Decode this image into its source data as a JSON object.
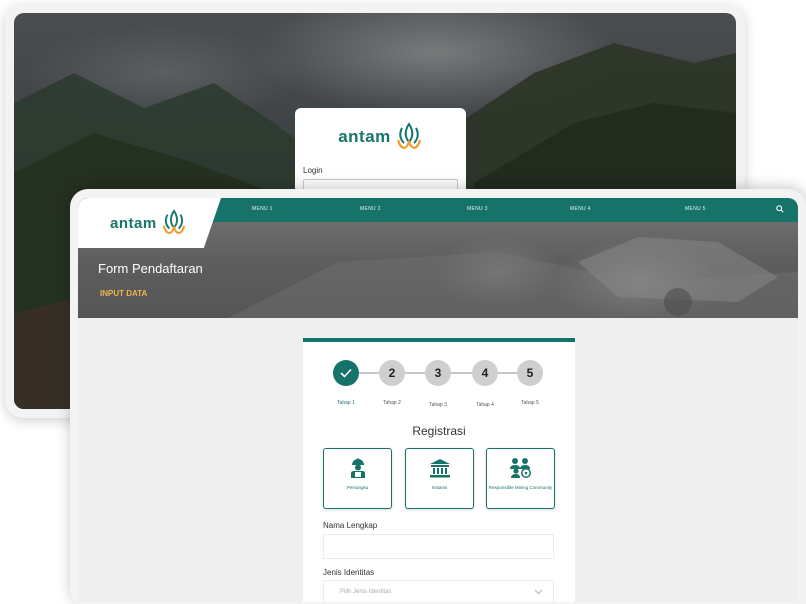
{
  "login": {
    "logo_text": "antam",
    "login_label": "Login"
  },
  "header": {
    "logo_text": "antam",
    "menu": [
      "MENU 1",
      "MENU 2",
      "MENU 3",
      "MENU 4",
      "MENU 5"
    ]
  },
  "hero": {
    "title": "Form Pendaftaran",
    "subtitle": "INPUT DATA"
  },
  "form": {
    "steps": [
      {
        "number": "",
        "label": "Tahap 1",
        "done": true
      },
      {
        "number": "2",
        "label": "Tahap 2",
        "done": false
      },
      {
        "number": "3",
        "label": "Tahap 3",
        "done": false
      },
      {
        "number": "4",
        "label": "Tahap 4",
        "done": false
      },
      {
        "number": "5",
        "label": "Tahap 5",
        "done": false
      }
    ],
    "title": "Registrasi",
    "options": [
      {
        "label": "Pemangku",
        "icon": "worker-icon"
      },
      {
        "label": "Instansi",
        "icon": "institution-icon"
      },
      {
        "label": "Responsible Mining Community",
        "icon": "community-icon"
      }
    ],
    "name_label": "Nama Lengkap",
    "name_value": "",
    "id_label": "Jenis Identitas",
    "id_placeholder": "Pilih Jenis Identitas"
  },
  "colors": {
    "brand": "#16736a",
    "accent": "#f0b54a",
    "logo_orange": "#f29a2e"
  }
}
